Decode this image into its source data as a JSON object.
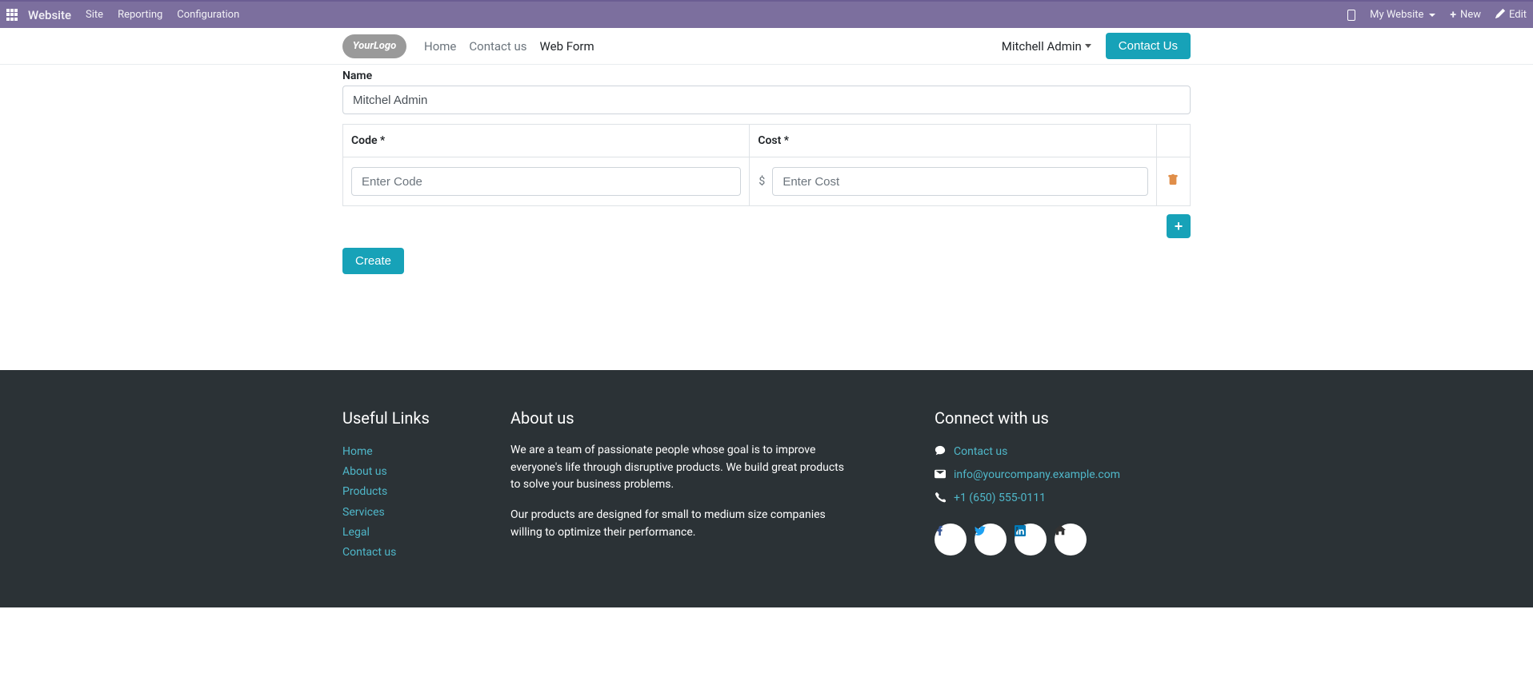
{
  "topbar": {
    "brand": "Website",
    "menu": [
      "Site",
      "Reporting",
      "Configuration"
    ],
    "website_selector": "My Website",
    "new_label": "New",
    "edit_label": "Edit"
  },
  "navbar": {
    "logo_text": "YourLogo",
    "links": [
      {
        "label": "Home",
        "active": false
      },
      {
        "label": "Contact us",
        "active": false
      },
      {
        "label": "Web Form",
        "active": true
      }
    ],
    "user": "Mitchell Admin",
    "contact_btn": "Contact Us"
  },
  "form": {
    "name_label": "Name",
    "name_value": "Mitchel Admin",
    "code_header": "Code *",
    "cost_header": "Cost *",
    "code_placeholder": "Enter Code",
    "cost_placeholder": "Enter Cost",
    "currency_symbol": "$",
    "submit_label": "Create"
  },
  "footer": {
    "useful_title": "Useful Links",
    "useful_links": [
      "Home",
      "About us",
      "Products",
      "Services",
      "Legal",
      "Contact us"
    ],
    "about_title": "About us",
    "about_p1": "We are a team of passionate people whose goal is to improve everyone's life through disruptive products. We build great products to solve your business problems.",
    "about_p2": "Our products are designed for small to medium size companies willing to optimize their performance.",
    "connect_title": "Connect with us",
    "contact_link": "Contact us",
    "email": "info@yourcompany.example.com",
    "phone": "+1 (650) 555-0111"
  }
}
